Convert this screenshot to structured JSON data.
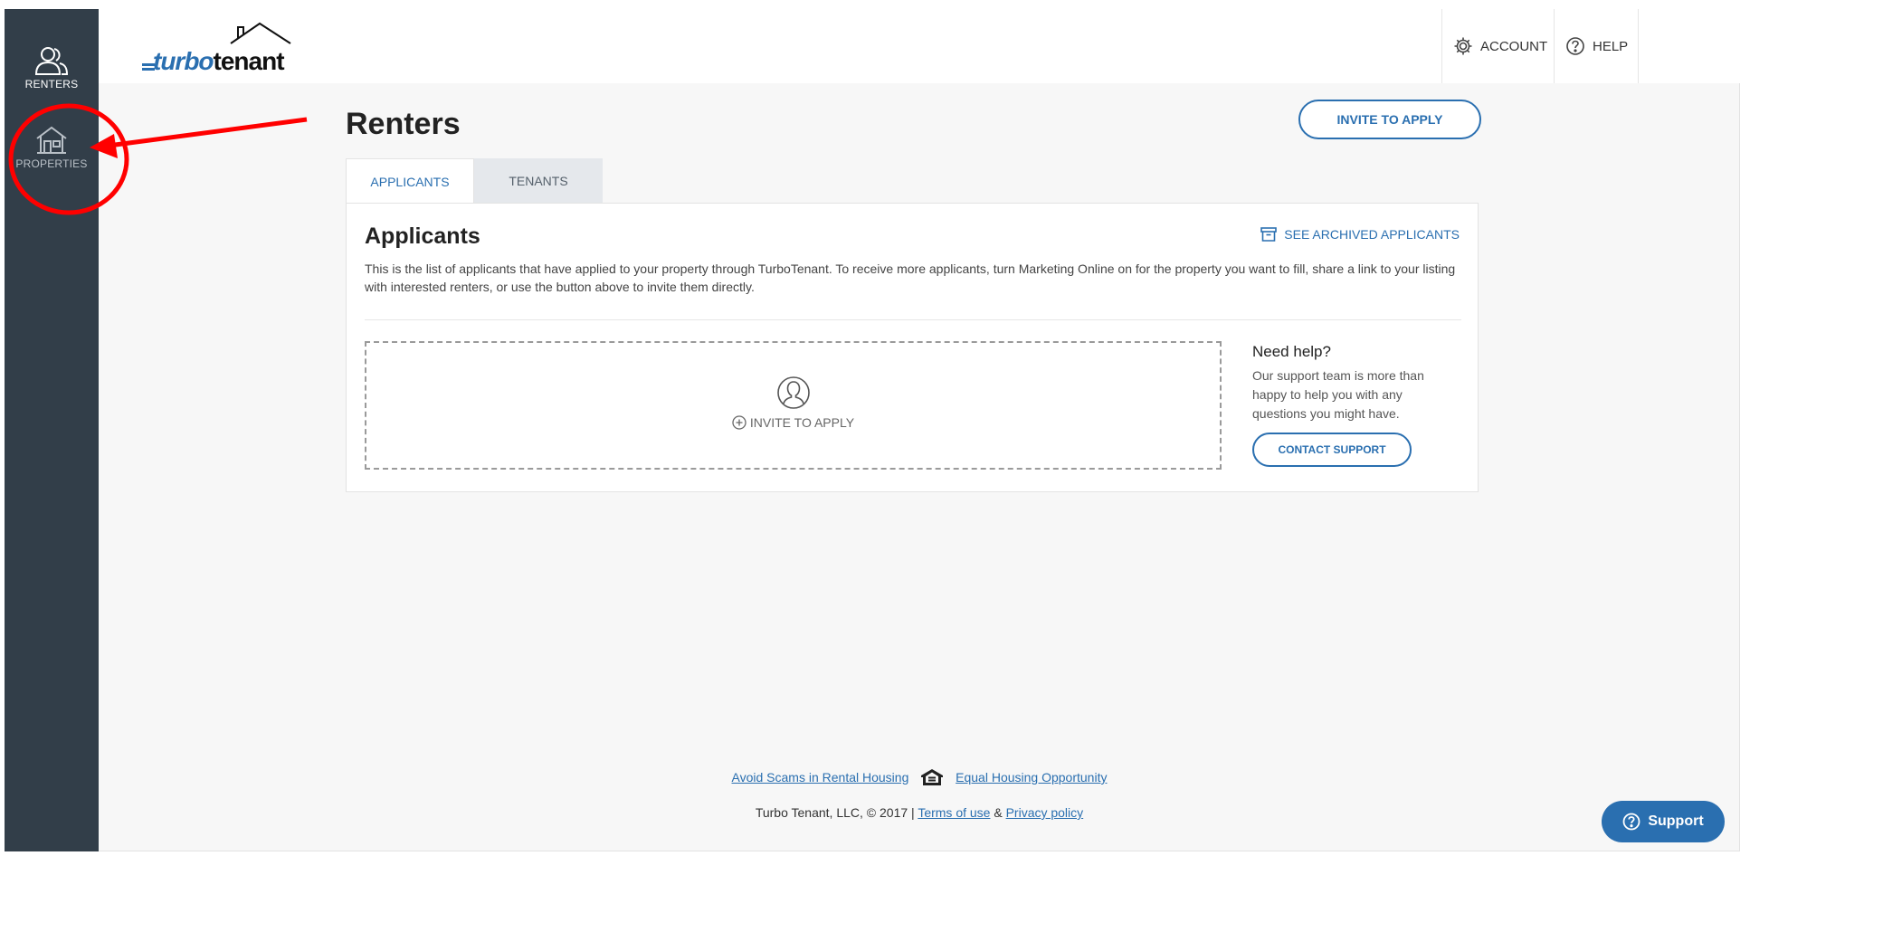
{
  "sidebar": {
    "items": [
      {
        "label": "RENTERS",
        "icon": "renters-icon"
      },
      {
        "label": "PROPERTIES",
        "icon": "house-icon"
      }
    ]
  },
  "header": {
    "logo": {
      "part1": "turbo",
      "part2": "tenant"
    },
    "account_label": "ACCOUNT",
    "help_label": "HELP"
  },
  "main": {
    "title": "Renters",
    "invite_button": "INVITE TO APPLY",
    "tabs": [
      {
        "label": "APPLICANTS",
        "active": true
      },
      {
        "label": "TENANTS",
        "active": false
      }
    ],
    "card": {
      "title": "Applicants",
      "archived_link": "SEE ARCHIVED APPLICANTS",
      "description": "This is the list of applicants that have applied to your property through TurboTenant. To receive more applicants, turn Marketing Online on for the property you want to fill, share a link to your listing with interested renters, or use the button above to invite them directly.",
      "dropzone_label": "INVITE TO APPLY",
      "help_title": "Need help?",
      "help_text": "Our support team is more than happy to help you with any questions you might have.",
      "contact_button": "CONTACT SUPPORT"
    }
  },
  "footer": {
    "scams_link": "Avoid Scams in Rental Housing",
    "eho_link": "Equal Housing Opportunity",
    "copyright": "Turbo Tenant, LLC, © 2017  |",
    "terms_link": "Terms of use",
    "amp": "&",
    "privacy_link": "Privacy policy"
  },
  "support_button": "Support",
  "colors": {
    "sidebar": "#323e49",
    "accent": "#2a6fb0",
    "annotation": "#ff0000",
    "background": "#f7f7f7"
  }
}
